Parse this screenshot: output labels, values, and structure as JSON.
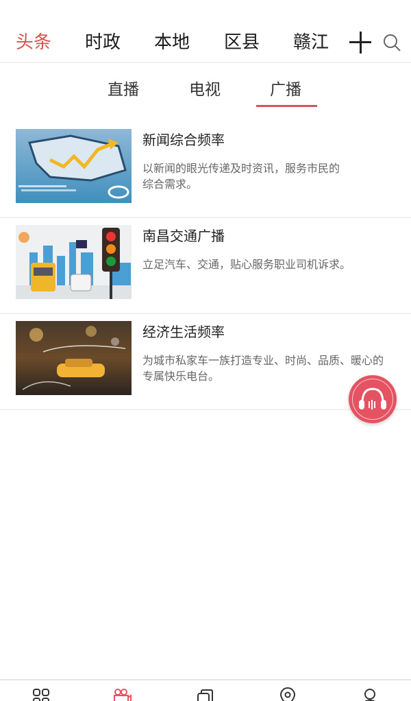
{
  "topnav": {
    "tabs": [
      {
        "label": "头条",
        "active": true
      },
      {
        "label": "时政",
        "active": false
      },
      {
        "label": "本地",
        "active": false
      },
      {
        "label": "区县",
        "active": false
      },
      {
        "label": "赣江",
        "active": false
      }
    ],
    "add_icon": "plus-icon",
    "search_icon": "search-icon"
  },
  "subtabs": [
    {
      "label": "直播",
      "active": false
    },
    {
      "label": "电视",
      "active": false
    },
    {
      "label": "广播",
      "active": true
    }
  ],
  "colors": {
    "accent": "#d9534f",
    "fab": "#e55262"
  },
  "channels": [
    {
      "title": "新闻综合频率",
      "desc": "以新闻的眼光传递及时资讯，服务市民的综合需求。",
      "thumb": "business-map-growth-image"
    },
    {
      "title": "南昌交通广播",
      "desc": "立足汽车、交通，贴心服务职业司机诉求。",
      "thumb": "traffic-light-city-image"
    },
    {
      "title": "经济生活频率",
      "desc": "为城市私家车一族打造专业、时尚、品质、暖心的专属快乐电台。",
      "thumb": "rainy-taxi-music-image"
    }
  ],
  "fab": {
    "icon": "headphones-icon"
  },
  "bottomnav": [
    {
      "icon": "grid-icon",
      "active": false
    },
    {
      "icon": "video-camera-icon",
      "active": true
    },
    {
      "icon": "copy-cards-icon",
      "active": false
    },
    {
      "icon": "location-pin-icon",
      "active": false
    },
    {
      "icon": "user-icon",
      "active": false
    }
  ]
}
